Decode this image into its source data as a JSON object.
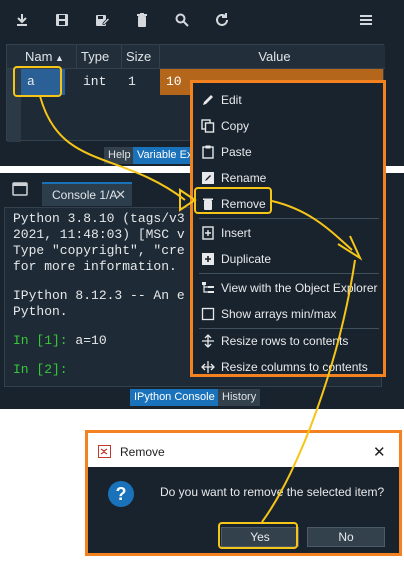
{
  "variable_explorer": {
    "toolbar_icons": [
      "import-data-icon",
      "save-icon",
      "save-as-icon",
      "delete-all-icon",
      "search-icon",
      "refresh-icon",
      "hamburger-menu-icon"
    ],
    "columns": [
      "Nam",
      "Type",
      "Size",
      "Value"
    ],
    "row": {
      "name": "a",
      "type": "int",
      "size": "1",
      "value": "10"
    },
    "tabs": [
      "Help",
      "Variable Ex"
    ]
  },
  "console": {
    "tab_label": "Console 1/A",
    "lines": [
      "Python 3.8.10 (tags/v3",
      "2021, 11:48:03) [MSC v",
      "Type \"copyright\", \"cre",
      "for more information.",
      "",
      "IPython 8.12.3 -- An e",
      "Python."
    ],
    "prompt1": "In [1]:",
    "input1": " a=10",
    "prompt2": "In [2]:",
    "tabs": [
      "IPython Console",
      "History"
    ]
  },
  "context_menu": {
    "items": [
      "Edit",
      "Copy",
      "Paste",
      "Rename",
      "Remove",
      "Insert",
      "Duplicate",
      "View with the Object Explorer",
      "Show arrays min/max",
      "Resize rows to contents",
      "Resize columns to contents"
    ]
  },
  "dialog": {
    "title": "Remove",
    "close": "✕",
    "icon": "?",
    "message": "Do you want to remove the selected item?",
    "yes": "Yes",
    "no": "No"
  },
  "colors": {
    "accent_orange": "#f58220",
    "highlight_yellow": "#f5c518",
    "selection_value": "#b4661b",
    "tab_active": "#1a72bb",
    "prompt_green": "#37c837"
  }
}
